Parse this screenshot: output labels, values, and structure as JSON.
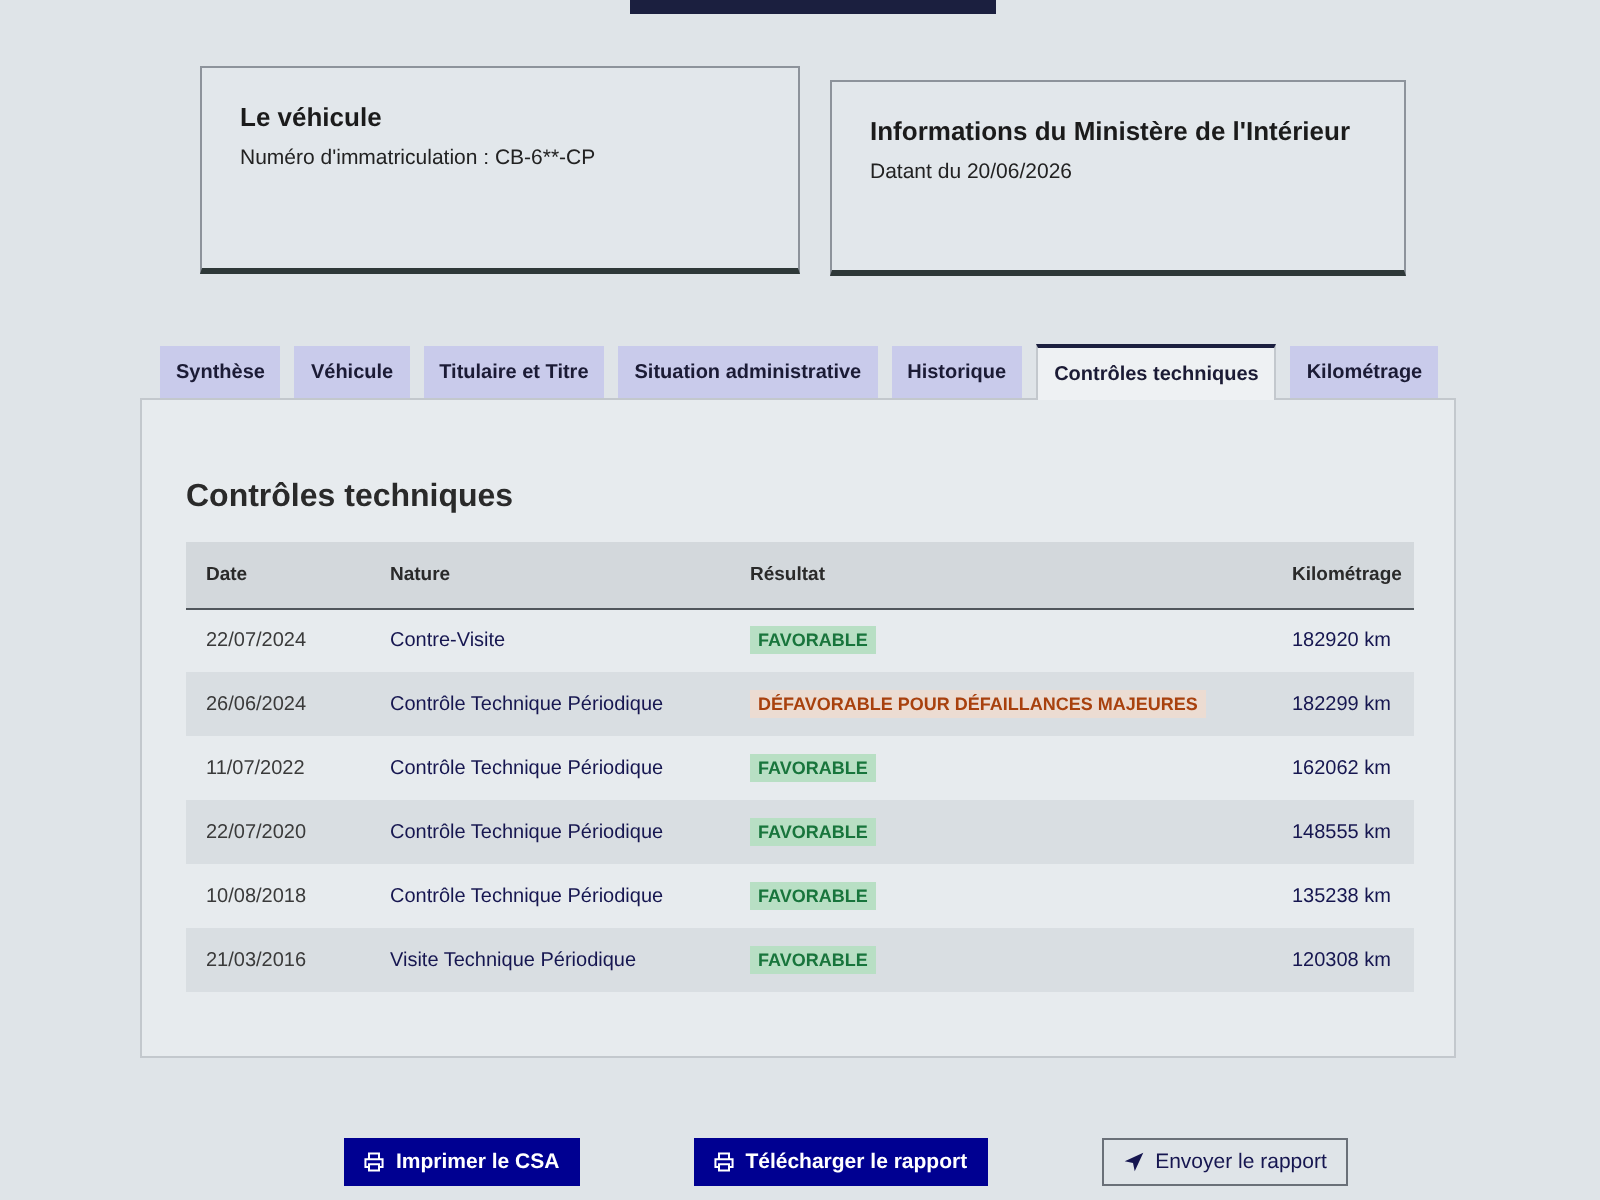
{
  "vehicle_card": {
    "title": "Le véhicule",
    "registration": "Numéro d'immatriculation : CB-6**-CP"
  },
  "ministry_card": {
    "title": "Informations du Ministère de l'Intérieur",
    "date": "Datant du 20/06/2026"
  },
  "tabs": [
    {
      "label": "Synthèse",
      "selected": false
    },
    {
      "label": "Véhicule",
      "selected": false
    },
    {
      "label": "Titulaire et Titre",
      "selected": false
    },
    {
      "label": "Situation administrative",
      "selected": false
    },
    {
      "label": "Historique",
      "selected": false
    },
    {
      "label": "Contrôles techniques",
      "selected": true
    },
    {
      "label": "Kilométrage",
      "selected": false
    }
  ],
  "panel": {
    "title": "Contrôles techniques"
  },
  "table": {
    "columns": [
      "Date",
      "Nature",
      "Résultat",
      "Kilométrage"
    ],
    "rows": [
      {
        "date": "22/07/2024",
        "nature": "Contre-Visite",
        "result": {
          "label": "FAVORABLE",
          "kind": "success"
        },
        "mileage": "182920 km"
      },
      {
        "date": "26/06/2024",
        "nature": "Contrôle Technique Périodique",
        "result": {
          "label": "DÉFAVORABLE POUR DÉFAILLANCES MAJEURES",
          "kind": "error"
        },
        "mileage": "182299 km"
      },
      {
        "date": "11/07/2022",
        "nature": "Contrôle Technique Périodique",
        "result": {
          "label": "FAVORABLE",
          "kind": "success"
        },
        "mileage": "162062 km"
      },
      {
        "date": "22/07/2020",
        "nature": "Contrôle Technique Périodique",
        "result": {
          "label": "FAVORABLE",
          "kind": "success"
        },
        "mileage": "148555 km"
      },
      {
        "date": "10/08/2018",
        "nature": "Contrôle Technique Périodique",
        "result": {
          "label": "FAVORABLE",
          "kind": "success"
        },
        "mileage": "135238 km"
      },
      {
        "date": "21/03/2016",
        "nature": "Visite Technique Périodique",
        "result": {
          "label": "FAVORABLE",
          "kind": "success"
        },
        "mileage": "120308 km"
      }
    ]
  },
  "buttons": [
    {
      "label": "Imprimer le CSA",
      "kind": "primary"
    },
    {
      "label": "Télécharger le rapport",
      "kind": "primary"
    },
    {
      "label": "Envoyer le rapport",
      "kind": "secondary"
    }
  ]
}
